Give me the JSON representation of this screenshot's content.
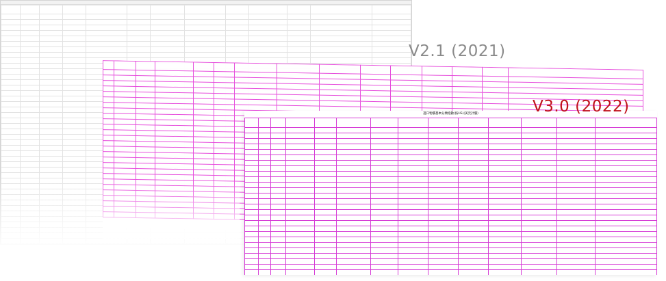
{
  "labels": {
    "v21": "V2.1 (2021)",
    "v30": "V3.0 (2022)"
  },
  "sheet_v30": {
    "title": "進口物價基本分類指數(按HS)(美元計價)"
  },
  "colors": {
    "grid_magenta": "#e64ddc",
    "label_red": "#c0101b",
    "label_gray": "#8a8a8a"
  }
}
